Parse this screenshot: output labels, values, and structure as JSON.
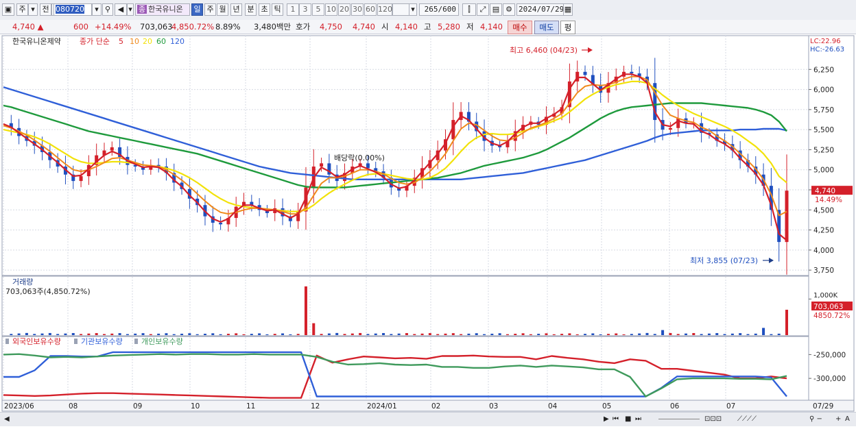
{
  "toolbar": {
    "period_main": "주",
    "compare": "전",
    "code": "080720",
    "stock_name": "한국유니온",
    "stock_tag": "종",
    "periods": [
      "일",
      "주",
      "월",
      "년",
      "분",
      "초",
      "틱"
    ],
    "selected_period": "일",
    "intervals": [
      "1",
      "3",
      "5",
      "10",
      "20",
      "30",
      "60",
      "120"
    ],
    "count": "265",
    "count_total": "/600",
    "date": "2024/07/29"
  },
  "quote": {
    "price": "4,740",
    "change": "600",
    "change_pct": "+14.49%",
    "volume": "703,063",
    "volume_pct": "4,850.72%",
    "turnover_rate": "8.89%",
    "amount": "3,480백만",
    "hoga_label": "호가",
    "ask": "4,750",
    "bid": "4,740",
    "open_label": "시",
    "open": "4,140",
    "high_label": "고",
    "high": "5,280",
    "low_label": "저",
    "low": "4,140",
    "buy_label": "매수",
    "sell_label": "매도",
    "eval_label": "평"
  },
  "colors": {
    "up": "#d4202a",
    "down": "#1f4fbf",
    "ma5": "#d4202a",
    "ma10": "#f08a1c",
    "ma20": "#f2e20a",
    "ma60": "#1e9a3c",
    "ma120": "#2f5fd8",
    "foreign": "#d4202a",
    "institution": "#2f5fd8",
    "individual": "#3f9a5c"
  },
  "chart_data": [
    {
      "type": "candlestick",
      "title": "한국유니온제약",
      "ma_label": "종가 단순",
      "ma_periods": [
        "5",
        "10",
        "20",
        "60",
        "120"
      ],
      "lc": "LC:22.96",
      "hc": "HC:-26.63",
      "ylim": [
        3700,
        6500
      ],
      "yticks": [
        "6,250",
        "6,000",
        "5,750",
        "5,500",
        "5,250",
        "5,000",
        "4,750",
        "4,500",
        "4,250",
        "4,000",
        "3,750"
      ],
      "ytick_values": [
        6250,
        6000,
        5750,
        5500,
        5250,
        5000,
        4750,
        4500,
        4250,
        4000,
        3750
      ],
      "xticks": [
        "2023/06",
        "08",
        "09",
        "10",
        "11",
        "12",
        "2024/01",
        "02",
        "03",
        "04",
        "05",
        "06",
        "07",
        "07/29"
      ],
      "current_price": "4,740",
      "current_pct": "14.49%",
      "high_annotation": "최고 6,460 (04/23)",
      "low_annotation": "최저 3,855 (07/23)",
      "event_annotation": "배당락(0.00%)",
      "close_path": [
        5580,
        5520,
        5420,
        5360,
        5300,
        5220,
        5120,
        5040,
        4940,
        4860,
        4920,
        5060,
        5180,
        5240,
        5280,
        5160,
        5060,
        5040,
        5000,
        5060,
        5040,
        4960,
        4840,
        4760,
        4640,
        4560,
        4420,
        4340,
        4320,
        4400,
        4540,
        4600,
        4560,
        4500,
        4460,
        4520,
        4420,
        4360,
        4480,
        4780,
        5040,
        5080,
        4940,
        4860,
        4960,
        5040,
        5080,
        5020,
        4980,
        4900,
        4780,
        4740,
        4800,
        4900,
        5020,
        5120,
        5240,
        5380,
        5620,
        5720,
        5600,
        5480,
        5360,
        5300,
        5280,
        5360,
        5480,
        5560,
        5600,
        5560,
        5660,
        5700,
        5780,
        6100,
        6220,
        6180,
        6060,
        5960,
        6080,
        6160,
        6220,
        6200,
        6160,
        6080,
        5620,
        5500,
        5520,
        5640,
        5580,
        5580,
        5460,
        5440,
        5360,
        5320,
        5240,
        5120,
        5040,
        4940,
        4800,
        4500,
        4100,
        4740
      ],
      "ma5_path": [
        5570,
        5530,
        5460,
        5390,
        5320,
        5250,
        5170,
        5090,
        5000,
        4920,
        4930,
        5010,
        5100,
        5180,
        5230,
        5190,
        5110,
        5070,
        5030,
        5040,
        5030,
        4970,
        4870,
        4790,
        4680,
        4590,
        4480,
        4390,
        4350,
        4390,
        4490,
        4560,
        4560,
        4520,
        4490,
        4500,
        4450,
        4400,
        4450,
        4650,
        4900,
        5030,
        4980,
        4910,
        4940,
        5010,
        5050,
        5010,
        4970,
        4910,
        4820,
        4770,
        4790,
        4870,
        4980,
        5090,
        5200,
        5330,
        5540,
        5670,
        5620,
        5510,
        5400,
        5330,
        5300,
        5350,
        5450,
        5530,
        5580,
        5580,
        5640,
        5690,
        5760,
        6010,
        6150,
        6150,
        6070,
        5990,
        6060,
        6130,
        6190,
        6190,
        6160,
        6080,
        5720,
        5560,
        5540,
        5610,
        5580,
        5570,
        5480,
        5440,
        5370,
        5320,
        5250,
        5140,
        5050,
        4950,
        4810,
        4560,
        4200,
        4120
      ],
      "ma10_path": [
        5550,
        5520,
        5480,
        5430,
        5370,
        5300,
        5230,
        5150,
        5070,
        5000,
        4980,
        5000,
        5040,
        5090,
        5140,
        5150,
        5120,
        5090,
        5060,
        5050,
        5040,
        5000,
        4940,
        4870,
        4790,
        4700,
        4610,
        4530,
        4470,
        4450,
        4470,
        4500,
        4520,
        4520,
        4510,
        4500,
        4480,
        4450,
        4450,
        4530,
        4680,
        4830,
        4900,
        4900,
        4920,
        4960,
        5000,
        5000,
        4980,
        4950,
        4890,
        4840,
        4820,
        4840,
        4900,
        4980,
        5080,
        5200,
        5360,
        5510,
        5580,
        5560,
        5490,
        5420,
        5370,
        5360,
        5400,
        5460,
        5520,
        5550,
        5590,
        5640,
        5700,
        5830,
        5960,
        6040,
        6060,
        6050,
        6060,
        6090,
        6130,
        6160,
        6160,
        6120,
        5960,
        5800,
        5680,
        5640,
        5610,
        5590,
        5530,
        5490,
        5420,
        5360,
        5290,
        5200,
        5110,
        5010,
        4880,
        4690,
        4430,
        4480
      ],
      "ma20_path": [
        5500,
        5480,
        5460,
        5440,
        5410,
        5370,
        5320,
        5260,
        5200,
        5140,
        5100,
        5080,
        5080,
        5090,
        5100,
        5100,
        5090,
        5080,
        5060,
        5050,
        5040,
        5020,
        4990,
        4950,
        4900,
        4840,
        4770,
        4700,
        4640,
        4590,
        4560,
        4540,
        4530,
        4520,
        4510,
        4500,
        4490,
        4480,
        4480,
        4500,
        4560,
        4640,
        4710,
        4770,
        4820,
        4870,
        4910,
        4940,
        4950,
        4950,
        4930,
        4910,
        4890,
        4880,
        4880,
        4900,
        4950,
        5020,
        5120,
        5230,
        5330,
        5400,
        5440,
        5450,
        5440,
        5440,
        5450,
        5480,
        5510,
        5540,
        5570,
        5610,
        5650,
        5720,
        5800,
        5880,
        5940,
        5990,
        6030,
        6060,
        6080,
        6100,
        6100,
        6080,
        6010,
        5930,
        5860,
        5800,
        5750,
        5700,
        5660,
        5620,
        5580,
        5540,
        5490,
        5430,
        5360,
        5290,
        5200,
        5080,
        4920,
        4840
      ],
      "ma60_path": [
        5800,
        5780,
        5750,
        5720,
        5690,
        5660,
        5630,
        5600,
        5570,
        5540,
        5510,
        5480,
        5460,
        5440,
        5420,
        5400,
        5380,
        5360,
        5340,
        5320,
        5300,
        5280,
        5260,
        5240,
        5220,
        5200,
        5170,
        5140,
        5110,
        5080,
        5050,
        5020,
        4990,
        4960,
        4930,
        4900,
        4870,
        4840,
        4810,
        4790,
        4780,
        4780,
        4780,
        4780,
        4780,
        4790,
        4800,
        4810,
        4820,
        4830,
        4840,
        4850,
        4860,
        4870,
        4880,
        4890,
        4900,
        4920,
        4940,
        4960,
        4990,
        5020,
        5050,
        5070,
        5090,
        5110,
        5130,
        5150,
        5180,
        5210,
        5250,
        5300,
        5350,
        5400,
        5460,
        5520,
        5580,
        5640,
        5690,
        5730,
        5760,
        5780,
        5790,
        5800,
        5810,
        5820,
        5830,
        5830,
        5830,
        5830,
        5830,
        5820,
        5810,
        5800,
        5790,
        5780,
        5770,
        5750,
        5720,
        5680,
        5600,
        5480
      ],
      "ma120_path": [
        6030,
        6000,
        5970,
        5940,
        5910,
        5880,
        5850,
        5820,
        5790,
        5760,
        5730,
        5700,
        5670,
        5640,
        5610,
        5580,
        5550,
        5520,
        5490,
        5460,
        5430,
        5400,
        5370,
        5340,
        5310,
        5280,
        5250,
        5220,
        5190,
        5160,
        5130,
        5100,
        5070,
        5040,
        5020,
        5000,
        4980,
        4960,
        4950,
        4940,
        4930,
        4920,
        4910,
        4900,
        4890,
        4880,
        4880,
        4880,
        4880,
        4880,
        4880,
        4880,
        4880,
        4880,
        4880,
        4880,
        4880,
        4880,
        4880,
        4880,
        4890,
        4900,
        4910,
        4920,
        4930,
        4940,
        4950,
        4960,
        4980,
        5000,
        5020,
        5040,
        5060,
        5080,
        5100,
        5120,
        5150,
        5180,
        5210,
        5240,
        5270,
        5300,
        5330,
        5360,
        5400,
        5430,
        5450,
        5460,
        5470,
        5480,
        5490,
        5490,
        5490,
        5490,
        5490,
        5500,
        5500,
        5500,
        5510,
        5510,
        5510,
        5490
      ]
    },
    {
      "type": "bar",
      "title": "거래량",
      "subtitle": "703,063주(4,850.72%)",
      "ytick": "1,000K",
      "current_value": "703,063",
      "current_pct": "4850.72%",
      "ylim": [
        0,
        1500000
      ],
      "spikes": [
        {
          "index": 39,
          "value": 1350000
        },
        {
          "index": 40,
          "value": 330000
        },
        {
          "index": 85,
          "value": 140000
        },
        {
          "index": 98,
          "value": 200000
        },
        {
          "index": 101,
          "value": 703063
        }
      ],
      "base_volume": 40000
    },
    {
      "type": "line",
      "legend": [
        "외국인보유수량",
        "기관보유수량",
        "개인보유수량"
      ],
      "yticks": [
        "-250,000",
        "-300,000"
      ],
      "ytick_values": [
        -250000,
        -300000
      ],
      "ylim": [
        -343000,
        -225000
      ],
      "series": [
        {
          "name": "외국인보유수량",
          "values": [
            -335000,
            -336000,
            -337000,
            -336000,
            -334000,
            -332000,
            -331000,
            -331000,
            -332000,
            -333000,
            -334000,
            -335000,
            -336000,
            -337000,
            -338000,
            -339000,
            -340000,
            -341000,
            -341000,
            -341000,
            -252000,
            -267000,
            -260000,
            -254000,
            -256000,
            -258000,
            -257000,
            -259000,
            -253000,
            -253000,
            -252000,
            -254000,
            -255000,
            -255000,
            -260000,
            -253000,
            -257000,
            -260000,
            -265000,
            -268000,
            -260000,
            -263000,
            -280000,
            -280000,
            -284000,
            -288000,
            -292000,
            -300000,
            -300000,
            -296000,
            -300000
          ]
        },
        {
          "name": "기관보유수량",
          "values": [
            -297000,
            -297000,
            -283000,
            -253000,
            -253000,
            -254000,
            -254000,
            -245000,
            -245000,
            -245000,
            -245000,
            -245000,
            -245000,
            -245000,
            -245000,
            -245000,
            -245000,
            -245000,
            -245000,
            -245000,
            -338000,
            -338000,
            -338000,
            -338000,
            -338000,
            -338000,
            -338000,
            -338000,
            -338000,
            -338000,
            -338000,
            -338000,
            -338000,
            -338000,
            -338000,
            -338000,
            -338000,
            -338000,
            -338000,
            -338000,
            -338000,
            -338000,
            -320000,
            -296000,
            -296000,
            -296000,
            -296000,
            -296000,
            -296000,
            -298000,
            -338000
          ]
        },
        {
          "name": "개인보유수량",
          "values": [
            -250000,
            -249000,
            -252000,
            -256000,
            -255000,
            -256000,
            -254000,
            -252000,
            -251000,
            -250000,
            -249000,
            -250000,
            -249000,
            -249000,
            -250000,
            -250000,
            -249000,
            -250000,
            -250000,
            -250000,
            -255000,
            -265000,
            -271000,
            -270000,
            -268000,
            -271000,
            -272000,
            -271000,
            -276000,
            -276000,
            -278000,
            -278000,
            -275000,
            -273000,
            -276000,
            -273000,
            -275000,
            -277000,
            -281000,
            -281000,
            -297000,
            -338000,
            -321000,
            -302000,
            -300000,
            -300000,
            -300000,
            -301000,
            -301000,
            -302000,
            -295000
          ]
        }
      ]
    }
  ],
  "bottombar": {
    "scroll_left": "◀",
    "play": "▶",
    "tools": "⏴⏵■▶"
  }
}
